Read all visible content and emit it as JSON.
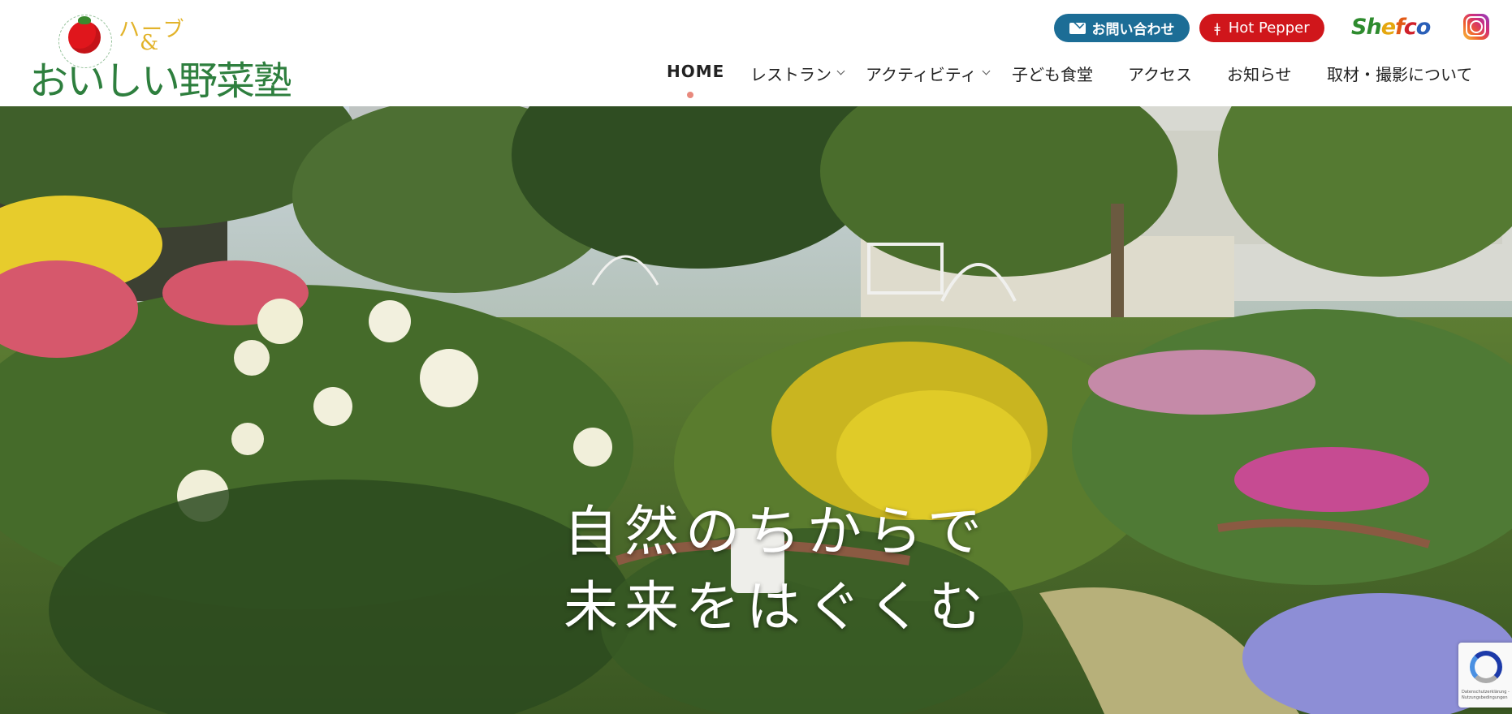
{
  "logo": {
    "herb": "ハーブ",
    "amp": "&",
    "name": "おいしい野菜塾"
  },
  "header_links": {
    "contact": "お問い合わせ",
    "hotpepper": "Hot Pepper",
    "shefco": [
      "S",
      "h",
      "e",
      "f",
      "c",
      "o"
    ]
  },
  "nav": {
    "items": [
      {
        "label": "HOME",
        "active": true
      },
      {
        "label": "レストラン",
        "dropdown": true
      },
      {
        "label": "アクティビティ",
        "dropdown": true
      },
      {
        "label": "子ども食堂"
      },
      {
        "label": "アクセス"
      },
      {
        "label": "お知らせ"
      },
      {
        "label": "取材・撮影について"
      }
    ]
  },
  "hero": {
    "line1": "自然のちからで",
    "line2": "未来をはぐくむ"
  },
  "recaptcha": {
    "text": "Datenschutzerklärung - Nutzungsbedingungen"
  },
  "colors": {
    "contact_button": "#1c6d96",
    "hotpepper_button": "#d0161b",
    "logo_green": "#2e7f3e",
    "logo_yellow": "#e2b32a",
    "active_dot": "#e8897d"
  }
}
